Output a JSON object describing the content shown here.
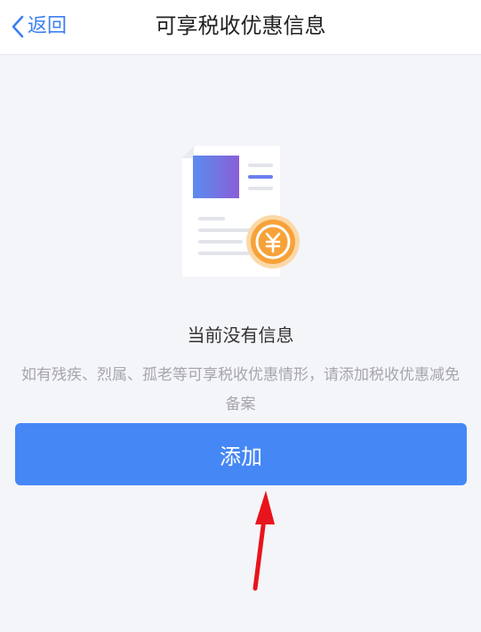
{
  "nav": {
    "back_label": "返回",
    "title": "可享税收优惠信息"
  },
  "empty_state": {
    "title": "当前没有信息",
    "description": "如有残疾、烈属、孤老等可享税收优惠情形，请添加税收优惠减免备案"
  },
  "actions": {
    "add_label": "添加"
  },
  "icons": {
    "back": "chevron-left-icon",
    "illustration": "document-yuan-icon",
    "annotation": "red-arrow-icon"
  },
  "colors": {
    "accent": "#4587f5",
    "back_link": "#3d7ff0",
    "coin": "#f7a239",
    "annotation_arrow": "#e8141b"
  }
}
